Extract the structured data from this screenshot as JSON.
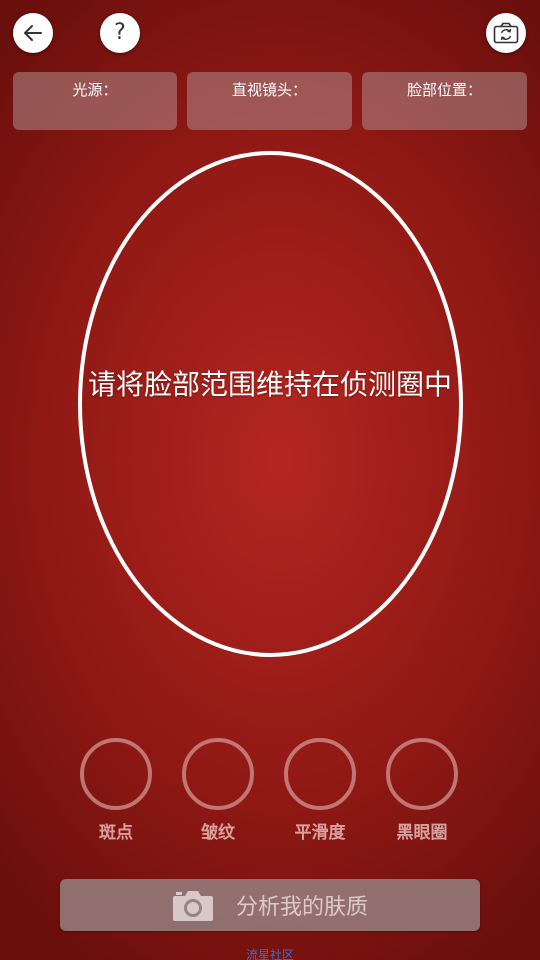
{
  "toolbar": {
    "back_icon": "arrow-left-icon",
    "help_label": "?",
    "camera_switch_icon": "camera-switch-icon"
  },
  "status": {
    "light_label": "光源：",
    "gaze_label": "直视镜头：",
    "face_position_label": "脸部位置："
  },
  "detection": {
    "instruction": "请将脸部范围维持在侦测圈中"
  },
  "metrics": [
    {
      "label": "斑点"
    },
    {
      "label": "皱纹"
    },
    {
      "label": "平滑度"
    },
    {
      "label": "黑眼圈"
    }
  ],
  "analyze": {
    "label": "分析我的肤质",
    "icon": "camera-icon"
  },
  "footer": {
    "link": "流星社区"
  },
  "colors": {
    "background": "#a21d18",
    "oval_stroke": "#ffffff",
    "link": "#3b6fd6"
  }
}
